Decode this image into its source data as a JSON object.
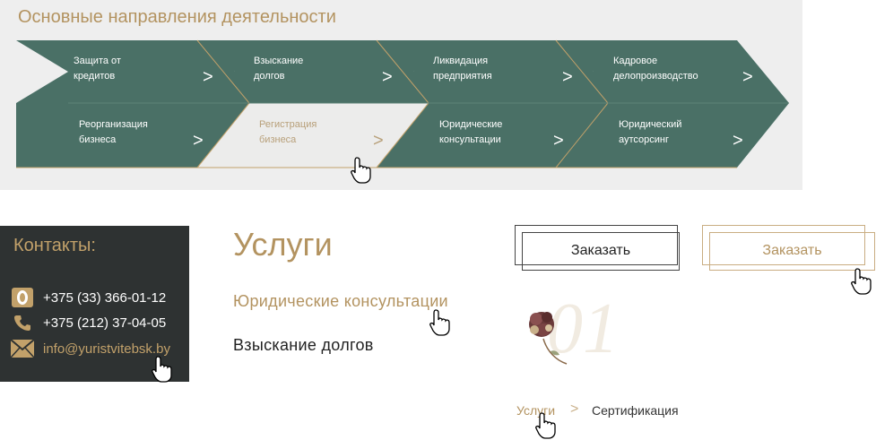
{
  "directions": {
    "title": "Основные направления деятельности",
    "row1": [
      {
        "label": "Защита от\nкредитов",
        "arrow": ">"
      },
      {
        "label": "Взыскание\nдолгов",
        "arrow": ">"
      },
      {
        "label": "Ликвидация\nпредприятия",
        "arrow": ">"
      },
      {
        "label": "Кадровое\nделопроизводство",
        "arrow": ">"
      }
    ],
    "row2": [
      {
        "label": "Реорганизация\nбизнеса",
        "arrow": ">"
      },
      {
        "label": "Регистрация\nбизнеса",
        "arrow": ">"
      },
      {
        "label": "Юридические\nконсультации",
        "arrow": ">"
      },
      {
        "label": "Юридический\nаутсорсинг",
        "arrow": ">"
      }
    ],
    "active": "Регистрация бизнеса"
  },
  "contacts": {
    "title": "Контакты:",
    "phone1": "+375 (33) 366-01-12",
    "phone2": "+375 (212) 37-04-05",
    "email": "info@yuristvitebsk.by"
  },
  "services": {
    "title": "Услуги",
    "link1": "Юридические консультации",
    "link2": "Взыскание долгов"
  },
  "buttons": {
    "order_default": "Заказать",
    "order_hover": "Заказать"
  },
  "decor": {
    "number": "01"
  },
  "breadcrumb": {
    "item1": "Услуги",
    "separator": ">",
    "item2": "Сертификация"
  },
  "colors": {
    "accent": "#b39360",
    "tile": "#4a7066",
    "tile_active": "#ececeb",
    "contacts_bg": "#2e3232"
  }
}
